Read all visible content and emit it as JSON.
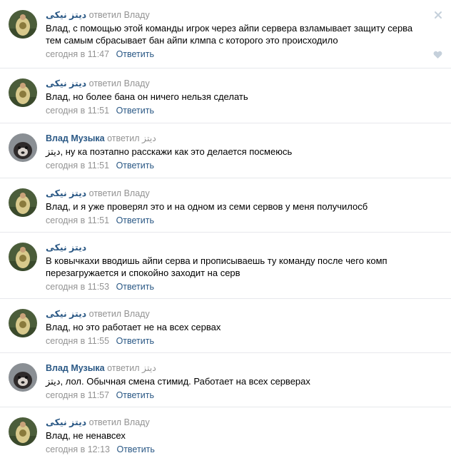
{
  "labels": {
    "replied_to": "ответил",
    "reply_action": "Ответить"
  },
  "icons": {
    "close": "close-icon",
    "like": "heart-icon"
  },
  "colors": {
    "link": "#2a5885",
    "muted": "#939393",
    "divider": "#e7e8ec",
    "icon": "#c5d0db"
  },
  "comments": [
    {
      "author": "ديتز نيكى",
      "verb": "ответил",
      "target": "Владу",
      "text": "Влад, с помощью этой команды игрок через айпи сервера взламывает защиту серва тем самым сбрасывает бан айпи клмпа с которого это происходило",
      "time": "сегодня в 11:47",
      "reply": "Ответить",
      "avatar": "avatar-1"
    },
    {
      "author": "ديتز نيكى",
      "verb": "ответил",
      "target": "Владу",
      "text": "Влад, но более бана он ничего нельзя сделать",
      "time": "сегодня в 11:51",
      "reply": "Ответить",
      "avatar": "avatar-1"
    },
    {
      "author": "Влад Музыка",
      "verb": "ответил",
      "target": "ديتز",
      "text": "ديتز, ну ка поэтапно расскажи как это делается посмеюсь",
      "time": "сегодня в 11:51",
      "reply": "Ответить",
      "avatar": "avatar-2"
    },
    {
      "author": "ديتز نيكى",
      "verb": "ответил",
      "target": "Владу",
      "text": "Влад, и я уже проверял это и на одном из семи сервов у меня получилосб",
      "time": "сегодня в 11:51",
      "reply": "Ответить",
      "avatar": "avatar-1"
    },
    {
      "author": "ديتز نيكى",
      "verb": "",
      "target": "",
      "text": "В ковычкахи вводишь айпи серва и прописываешь ту команду после чего комп перезагружается и спокойно заходит на серв",
      "time": "сегодня в 11:53",
      "reply": "Ответить",
      "avatar": "avatar-1"
    },
    {
      "author": "ديتز نيكى",
      "verb": "ответил",
      "target": "Владу",
      "text": "Влад, но это работает не на всех сервах",
      "time": "сегодня в 11:55",
      "reply": "Ответить",
      "avatar": "avatar-1"
    },
    {
      "author": "Влад Музыка",
      "verb": "ответил",
      "target": "ديتز",
      "text": "ديتز, лол. Обычная смена стимид. Работает на всех серверах",
      "time": "сегодня в 11:57",
      "reply": "Ответить",
      "avatar": "avatar-2"
    },
    {
      "author": "ديتز نيكى",
      "verb": "ответил",
      "target": "Владу",
      "text": "Влад, не ненавсех",
      "time": "сегодня в 12:13",
      "reply": "Ответить",
      "avatar": "avatar-1"
    }
  ]
}
